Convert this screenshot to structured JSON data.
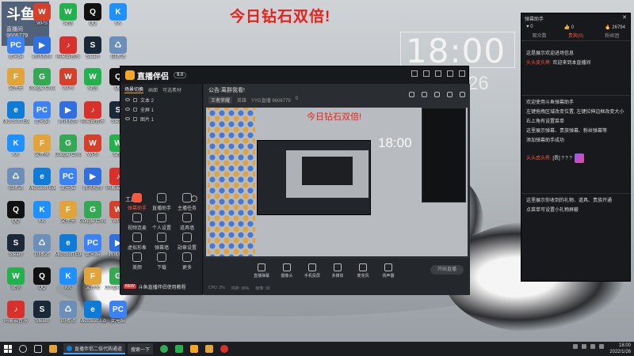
{
  "wallpaper": {
    "title": "今日钻石双倍!",
    "clock": "18:00",
    "date": "26"
  },
  "corner_logo": {
    "big": "斗鱼",
    "name": "直播间",
    "id": "9606779"
  },
  "desktop_icons": [
    {
      "label": "此电脑",
      "color": "#3b82f6",
      "glyph": "PC"
    },
    {
      "label": "文件夹",
      "color": "#e0a43a",
      "glyph": "F"
    },
    {
      "label": "Microsoft Edge",
      "color": "#0e7bd6",
      "glyph": "e"
    },
    {
      "label": "KK",
      "color": "#1e90ff",
      "glyph": "K"
    },
    {
      "label": "回收站",
      "color": "#6b8fb8",
      "glyph": "♺"
    },
    {
      "label": "QQ",
      "color": "#111",
      "glyph": "Q"
    },
    {
      "label": "Steam",
      "color": "#1b2838",
      "glyph": "S"
    },
    {
      "label": "微信",
      "color": "#22b14c",
      "glyph": "W"
    },
    {
      "label": "网易云音乐",
      "color": "#d8312b",
      "glyph": "♪"
    },
    {
      "label": "WPS",
      "color": "#d6402b",
      "glyph": "W"
    },
    {
      "label": "腾讯视频",
      "color": "#2f6fe0",
      "glyph": "▶"
    },
    {
      "label": "Google Chrome",
      "color": "#34a853",
      "glyph": "G"
    }
  ],
  "app": {
    "name": "直播伴侣",
    "version": "9.0",
    "left_tabs": [
      "场景切换",
      "画面",
      "可选素材"
    ],
    "sources": [
      "文本 2",
      "全屏 1",
      "图片 1"
    ],
    "tools_header": "工具箱",
    "tools": [
      {
        "label": "弹幕助手",
        "on": true
      },
      {
        "label": "直播助手",
        "on": false
      },
      {
        "label": "主播任务",
        "on": false
      },
      {
        "label": "视频连麦",
        "on": false
      },
      {
        "label": "个人设置",
        "on": false
      },
      {
        "label": "道具墙",
        "on": false
      },
      {
        "label": "虚拟形象",
        "on": false
      },
      {
        "label": "弹幕墙",
        "on": false
      },
      {
        "label": "勋章设置",
        "on": false
      },
      {
        "label": "美颜",
        "on": false
      },
      {
        "label": "下载",
        "on": false
      },
      {
        "label": "更多",
        "on": false
      }
    ],
    "promo": {
      "tag": "NEW",
      "text": "斗鱼直播伴侣使用教程"
    },
    "room": {
      "title": "公告:离群我看!",
      "category": "王者荣耀",
      "level": "英雄",
      "room_id": "YYG直播 9606779",
      "heat": "0"
    },
    "preview": {
      "title": "今日钻石双倍!",
      "clock": "18:00"
    },
    "bottom_buttons": [
      "直播弹幕",
      "摄像头",
      "手机投屏",
      "多媒体",
      "麦克风",
      "扬声器"
    ],
    "start_live": "开始直播",
    "status_items": [
      "CPU: 2%",
      "内存: 36%",
      "帧率: 30"
    ]
  },
  "chat": {
    "header": "弹幕助手",
    "stats": [
      "0",
      "0",
      "26794"
    ],
    "tabs": [
      "观众数",
      "贵宾(0)",
      "粉丝团"
    ],
    "messages": [
      {
        "text": "这是展示欢迎进场信息"
      },
      {
        "user": "头头皮头疼:",
        "text": "欢迎来到本直播间"
      },
      {
        "text": "欢迎使用斗鱼弹幕助手"
      },
      {
        "text": "左键拖拽区域改变位置, 左键拉伸边框改变大小"
      },
      {
        "text": "右上角有设置菜单"
      },
      {
        "text": "这里展示弹幕、贵族弹幕、粉丝弹幕等"
      },
      {
        "text": "添加弹幕助手成功"
      },
      {
        "user": "头头皮头疼:",
        "text": "[表] ? ? ?"
      },
      {
        "text": "这里展示你收到的礼物、道具、贵族开通"
      },
      {
        "text": "点菜单可设置小礼物屏蔽"
      }
    ]
  },
  "taskbar": {
    "task_label": "直播伴侣二倍代购通道",
    "task2_label": "搜索一下",
    "time": "18:00",
    "date": "2022/1/26"
  }
}
